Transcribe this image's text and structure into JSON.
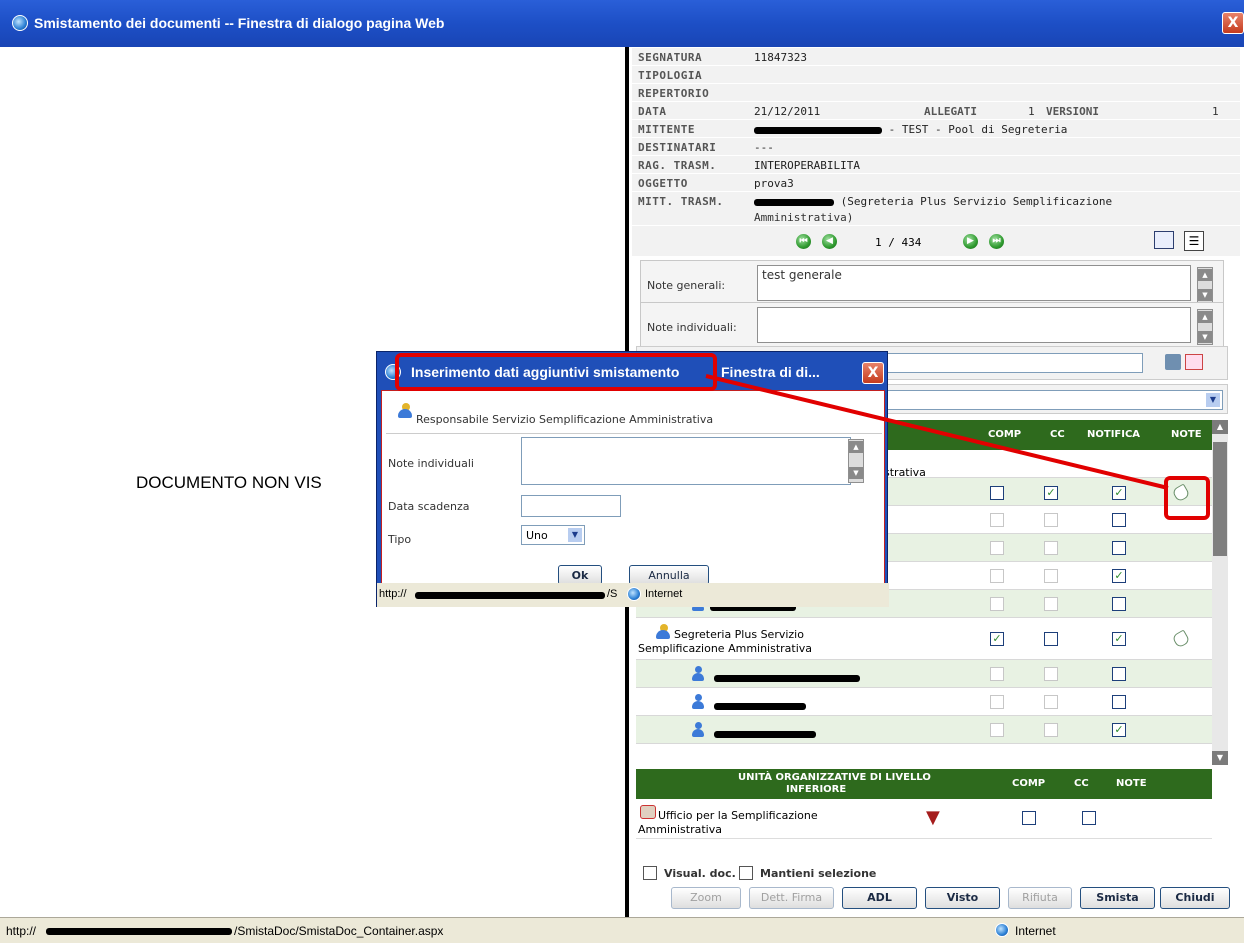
{
  "window": {
    "title": "Smistamento dei documenti -- Finestra di dialogo pagina Web",
    "close": "X"
  },
  "left": {
    "message": "DOCUMENTO NON VIS"
  },
  "info": {
    "segnatura_label": "SEGNATURA",
    "segnatura": "11847323",
    "tipologia_label": "TIPOLOGIA",
    "repertorio_label": "REPERTORIO",
    "data_label": "DATA",
    "data": "21/12/2011",
    "allegati_label": "ALLEGATI",
    "allegati": "1",
    "versioni_label": "VERSIONI",
    "versioni": "1",
    "mittente_label": "MITTENTE",
    "mittente_suffix": "- TEST - Pool di Segreteria",
    "destinatari_label": "DESTINATARI",
    "destinatari": "---",
    "ragtrasm_label": "RAG. TRASM.",
    "ragtrasm": "INTEROPERABILITA",
    "oggetto_label": "OGGETTO",
    "oggetto": "prova3",
    "mitttrasm_label": "MITT. TRASM.",
    "mitttrasm_line1": "(Segreteria Plus Servizio Semplificazione",
    "mitttrasm_line2": "Amministrativa)",
    "pager": "1 / 434"
  },
  "notes": {
    "generali_label": "Note generali:",
    "generali_value": "test generale",
    "individuali_label": "Note individuali:"
  },
  "grid": {
    "col_comp": "COMP",
    "col_cc": "CC",
    "col_notifica": "NOTIFICA",
    "col_note": "NOTE",
    "row0_text": "strativa",
    "seg_line1": "Segreteria Plus Servizio",
    "seg_line2": "Semplificazione Amministrativa",
    "check": "✓"
  },
  "uo": {
    "header_line1": "UNITÀ ORGANIZZATIVE DI LIVELLO",
    "header_line2": "INFERIORE",
    "col_comp": "COMP",
    "col_cc": "CC",
    "col_note": "NOTE",
    "row_line1": "Ufficio per la Semplificazione",
    "row_line2": "Amministrativa"
  },
  "options": {
    "visual_doc": "Visual. doc.",
    "mantieni": "Mantieni selezione"
  },
  "buttons": {
    "zoom": "Zoom",
    "dett_firma": "Dett. Firma",
    "adl": "ADL",
    "visto": "Visto",
    "rifiuta": "Rifiuta",
    "smista": "Smista",
    "chiudi": "Chiudi"
  },
  "status": {
    "url_prefix": "http://",
    "url_suffix": "/SmistaDoc/SmistaDoc_Container.aspx",
    "zone": "Internet"
  },
  "dialog": {
    "title_part1": "Inserimento dati aggiuntivi smistamento",
    "title_part2": "Finestra di di...",
    "role": "Responsabile Servizio Semplificazione Amministrativa",
    "note_label": "Note individuali",
    "scadenza_label": "Data scadenza",
    "tipo_label": "Tipo",
    "tipo_value": "Uno",
    "ok": "Ok",
    "annulla": "Annulla",
    "status_prefix": "http://",
    "status_suffix": "/S",
    "status_zone": "Internet"
  }
}
